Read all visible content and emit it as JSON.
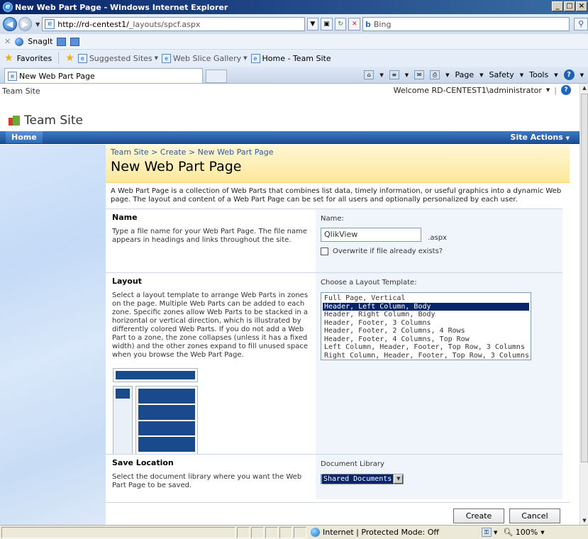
{
  "window": {
    "title": "New Web Part Page - Windows Internet Explorer"
  },
  "address": {
    "url_host": "http://rd-centest1/",
    "url_path": "_layouts/spcf.aspx",
    "search_placeholder": "Bing"
  },
  "snagit": {
    "label": "SnagIt"
  },
  "favorites": {
    "label": "Favorites",
    "items": [
      {
        "label": "Suggested Sites"
      },
      {
        "label": "Web Slice Gallery"
      },
      {
        "label": "Home - Team Site"
      }
    ]
  },
  "tab": {
    "label": "New Web Part Page"
  },
  "commandbar": {
    "page": "Page",
    "safety": "Safety",
    "tools": "Tools"
  },
  "sp": {
    "top_left": "Team Site",
    "welcome": "Welcome RD-CENTEST1\\administrator",
    "site_title": "Team Site",
    "nav_home": "Home",
    "site_actions": "Site Actions",
    "breadcrumb": "Team Site > Create > New Web Part Page",
    "page_title": "New Web Part Page",
    "intro": "A Web Part Page is a collection of Web Parts that combines list data, timely information, or useful graphics into a dynamic Web page. The layout and content of a Web Part Page can be set for all users and optionally personalized by each user."
  },
  "name_section": {
    "heading": "Name",
    "description": "Type a file name for your Web Part Page.  The file name appears in headings and links throughout the site.",
    "field_label": "Name:",
    "value": "QlikView",
    "extension": ".aspx",
    "overwrite_label": "Overwrite if file already exists?"
  },
  "layout_section": {
    "heading": "Layout",
    "description": "Select a layout template to arrange Web Parts in zones on the page. Multiple Web Parts can be added to each zone. Specific zones allow Web Parts to be stacked in a horizontal or vertical direction, which is illustrated by differently colored Web Parts. If you do not add a Web Part to a zone, the zone collapses (unless it has a fixed width) and the other zones expand to fill unused space when you browse the Web Part Page.",
    "field_label": "Choose a Layout Template:",
    "options": [
      "Full Page, Vertical",
      "Header, Left Column, Body",
      "Header, Right Column, Body",
      "Header, Footer, 3 Columns",
      "Header, Footer, 2 Columns, 4 Rows",
      "Header, Footer, 4 Columns, Top Row",
      "Left Column, Header, Footer, Top Row, 3 Columns",
      "Right Column, Header, Footer, Top Row, 3 Columns"
    ],
    "selected_index": 1
  },
  "save_section": {
    "heading": "Save Location",
    "description": "Select the document library where you want the Web Part Page to be saved.",
    "field_label": "Document Library",
    "selected": "Shared Documents"
  },
  "buttons": {
    "create": "Create",
    "cancel": "Cancel"
  },
  "status": {
    "zone": "Internet | Protected Mode: Off",
    "zoom": "100%"
  }
}
